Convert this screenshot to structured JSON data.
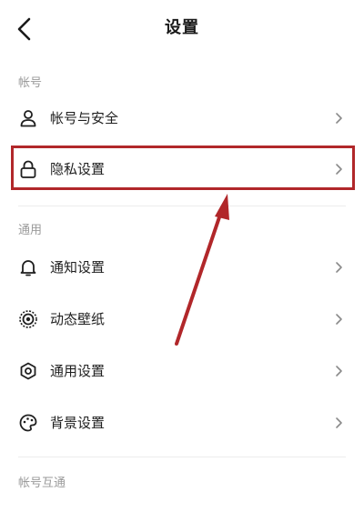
{
  "header": {
    "title": "设置",
    "back_icon": "chevron-left-icon"
  },
  "sections": {
    "account": {
      "label": "帐号",
      "items": [
        {
          "label": "帐号与安全",
          "icon": "user-icon"
        },
        {
          "label": "隐私设置",
          "icon": "lock-icon"
        }
      ]
    },
    "general": {
      "label": "通用",
      "items": [
        {
          "label": "通知设置",
          "icon": "bell-icon"
        },
        {
          "label": "动态壁纸",
          "icon": "live-wallpaper-icon"
        },
        {
          "label": "通用设置",
          "icon": "gear-icon"
        },
        {
          "label": "背景设置",
          "icon": "palette-icon"
        }
      ]
    },
    "interop": {
      "label": "帐号互通"
    }
  },
  "annotation": {
    "highlight_color": "#b1272a",
    "highlighted_item": "隐私设置"
  }
}
